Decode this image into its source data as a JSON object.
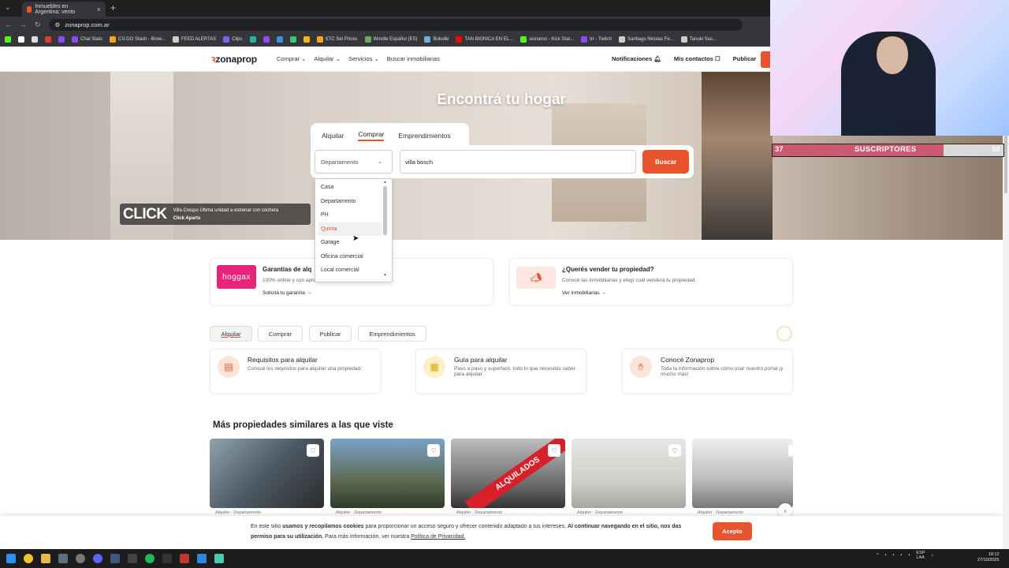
{
  "browser": {
    "tab_title": "Inmuebles en Argentina: vento",
    "url": "zonaprop.com.ar",
    "bookmarks": [
      "Chat Stats",
      "CS:GO Stash - Brow...",
      "FEED ALERTAS",
      "Clips",
      "STC Set Prices",
      "Wordle Español (ES)",
      "Boludle",
      "TAN BIONICA EN EL...",
      "sionaron - Kick Stat...",
      "trr - Twitch",
      "Santiago Nicolas Fe...",
      "Tanuki Sus..."
    ]
  },
  "site": {
    "logo": "zonaprop",
    "nav": [
      "Comprar ⌄",
      "Alquilar ⌄",
      "Servicios ⌄",
      "Buscar inmobiliarias"
    ],
    "right_nav": {
      "notifications": "Notificaciones",
      "contacts": "Mis contactos",
      "publish": "Publicar"
    }
  },
  "hero": {
    "title": "Encontrá tu hogar",
    "tabs": [
      "Alquilar",
      "Comprar",
      "Emprendimientos"
    ],
    "active_tab": "Comprar",
    "property_type": "Departamento",
    "location_value": "villa bosch",
    "search_button": "Buscar",
    "dropdown_options": [
      "Casa",
      "Departamento",
      "PH",
      "Quinta",
      "Garage",
      "Oficina comercial",
      "Local comercial"
    ],
    "highlighted_option": "Quinta"
  },
  "ad": {
    "brand": "CLICK",
    "line1": "Villa Crespo Última unidad a estrenar con cochera",
    "line2": "Click Aparts"
  },
  "promo_cards": [
    {
      "logo": "hoggax",
      "title": "Garantías de alq",
      "text": "100% online y con apro",
      "link": "Solicitá tu garantía →"
    },
    {
      "title": "¿Querés vender tu propiedad?",
      "text": "Conocé las inmobiliarias y elegí cuál venderá tu propiedad.",
      "link": "Ver inmobiliarias →"
    }
  ],
  "chips": [
    "Alquilar",
    "Comprar",
    "Publicar",
    "Emprendimientos"
  ],
  "info_cards": [
    {
      "title": "Requisitos para alquilar",
      "text": "Conocé los requisitos para alquilar una propiedad."
    },
    {
      "title": "Guía para alquilar",
      "text": "Paso a paso y superfacil, todo lo que necesitás saber para alquilar."
    },
    {
      "title": "Conocé Zonaprop",
      "text": "Toda la información sobre cómo usar nuestro portal ¡y mucho más!"
    }
  ],
  "similar": {
    "title": "Más propiedades similares a las que viste",
    "items": [
      {
        "label": "Alquiler · Departamento",
        "overlay": ""
      },
      {
        "label": "Alquiler · Departamento",
        "overlay": ""
      },
      {
        "label": "Alquiler · Departamento",
        "overlay": "ALQUILADOS"
      },
      {
        "label": "Alquiler · Departamento",
        "overlay": ""
      },
      {
        "label": "Alquiler · Departamento",
        "overlay": ""
      }
    ]
  },
  "cookie": {
    "p1": "En este sitio ",
    "b1": "usamos y recopilamos cookies",
    "p2": " para proporcionar un acceso seguro y ofrecer contenido adaptado a tus intereses. ",
    "b2": "Al continuar navegando en el sitio, nos das permiso para su utilización.",
    "p3": " Para más información, ver nuestra ",
    "link": "Política de Privacidad.",
    "button": "Acepto"
  },
  "overlay": {
    "left_count": "37",
    "label": "SUSCRIPTORES",
    "right_count": "50",
    "progress": 0.74
  },
  "taskbar": {
    "lang": "ESP\nLAA",
    "time": "18:12",
    "date": "27/10/2025"
  },
  "colors": {
    "brand": "#e8542e",
    "hoggax": "#e8247a",
    "sub_fill": "#c95a72"
  }
}
